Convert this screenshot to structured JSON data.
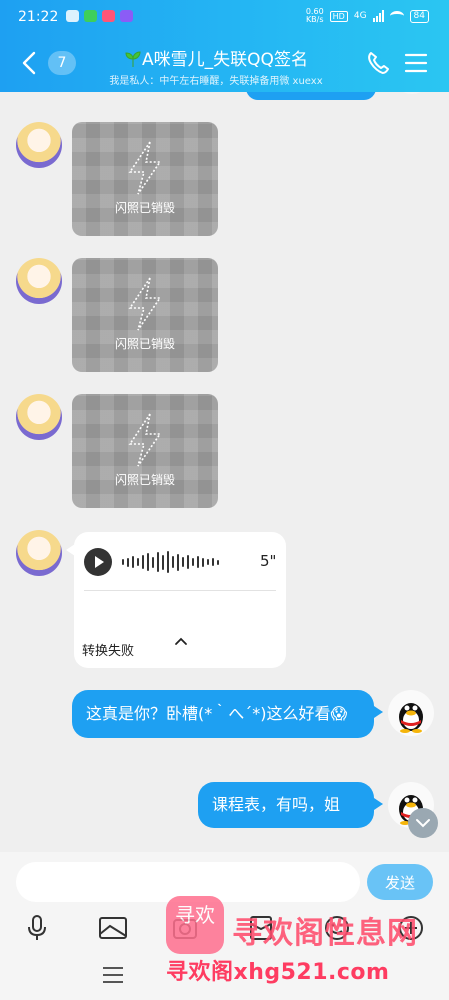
{
  "status_bar": {
    "time": "21:22",
    "net_speed_value": "0.60",
    "net_speed_unit": "KB/s",
    "hd": "HD",
    "network": "4G",
    "battery": "84"
  },
  "header": {
    "unread_count": "7",
    "title": "A咪雪儿_失联QQ签名",
    "subtitle": "我是私人：中午左右睡醒，失联掉备用微 xuexx"
  },
  "messages": {
    "flash_caption": "闪照已销毁",
    "voice_duration": "5\"",
    "voice_convert_status": "转换失败",
    "outgoing_1": "这真是你？卧槽(*｀へ´*)这么好看😱",
    "outgoing_2": "课程表，有吗，姐"
  },
  "composer": {
    "input_value": "",
    "send_label": "发送"
  },
  "watermark": {
    "logo_text": "寻欢",
    "name": "寻欢阁性息网",
    "url": "寻欢阁xhg521.com"
  },
  "colors": {
    "accent": "#1ea0f2",
    "chat_bg": "#efefef",
    "watermark": "#ff4d6d"
  },
  "icons": [
    "back-chevron-icon",
    "phone-icon",
    "menu-icon",
    "lightning-icon",
    "play-icon",
    "chevron-up-icon",
    "chevron-down-icon",
    "microphone-icon",
    "image-icon",
    "camera-icon",
    "red-packet-icon",
    "emoji-icon",
    "add-icon"
  ]
}
